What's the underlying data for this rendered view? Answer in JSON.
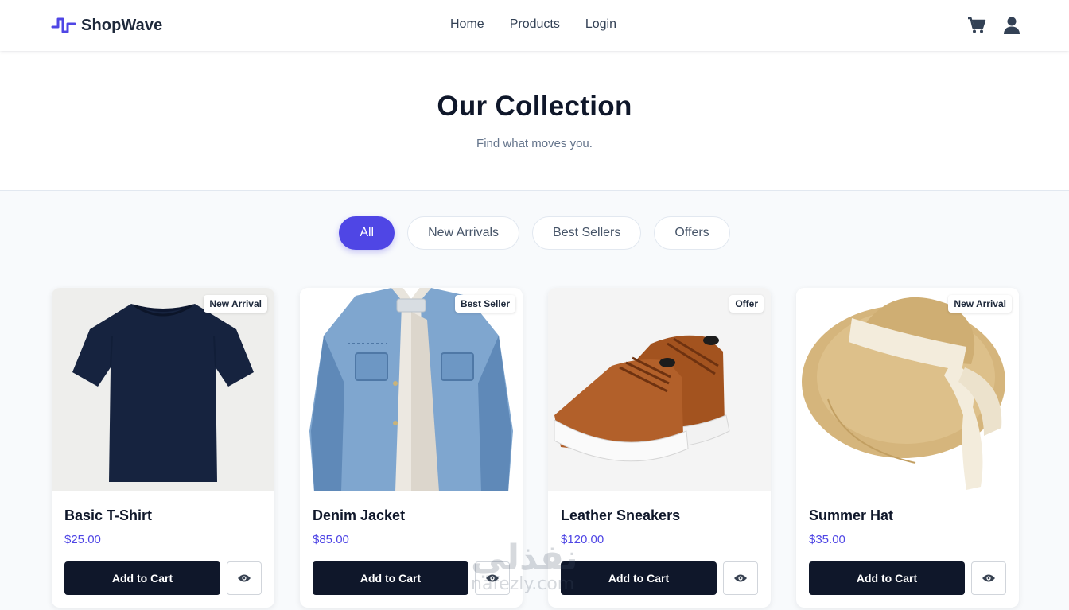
{
  "header": {
    "brand_name": "ShopWave",
    "nav": [
      "Home",
      "Products",
      "Login"
    ],
    "icons": [
      "cart-icon",
      "user-icon"
    ]
  },
  "hero": {
    "title": "Our Collection",
    "subtitle": "Find what moves you."
  },
  "filters": {
    "items": [
      "All",
      "New Arrivals",
      "Best Sellers",
      "Offers"
    ],
    "selected": "All"
  },
  "products": [
    {
      "name": "Basic T-Shirt",
      "price": "$25.00",
      "badge": "New Arrival",
      "cart_label": "Add to Cart",
      "image": "navy t-shirt"
    },
    {
      "name": "Denim Jacket",
      "price": "$85.00",
      "badge": "Best Seller",
      "cart_label": "Add to Cart",
      "image": "denim sherpa jacket"
    },
    {
      "name": "Leather Sneakers",
      "price": "$120.00",
      "badge": "Offer",
      "cart_label": "Add to Cart",
      "image": "brown leather sneakers"
    },
    {
      "name": "Summer Hat",
      "price": "$35.00",
      "badge": "New Arrival",
      "cart_label": "Add to Cart",
      "image": "straw sun hat with ribbon"
    }
  ],
  "watermark": {
    "arabic": "نفذلي",
    "latin": "nafezly.com"
  },
  "colors": {
    "accent": "#4f46e5",
    "dark": "#0f172a",
    "muted": "#64748b",
    "background": "#f8fafc"
  }
}
